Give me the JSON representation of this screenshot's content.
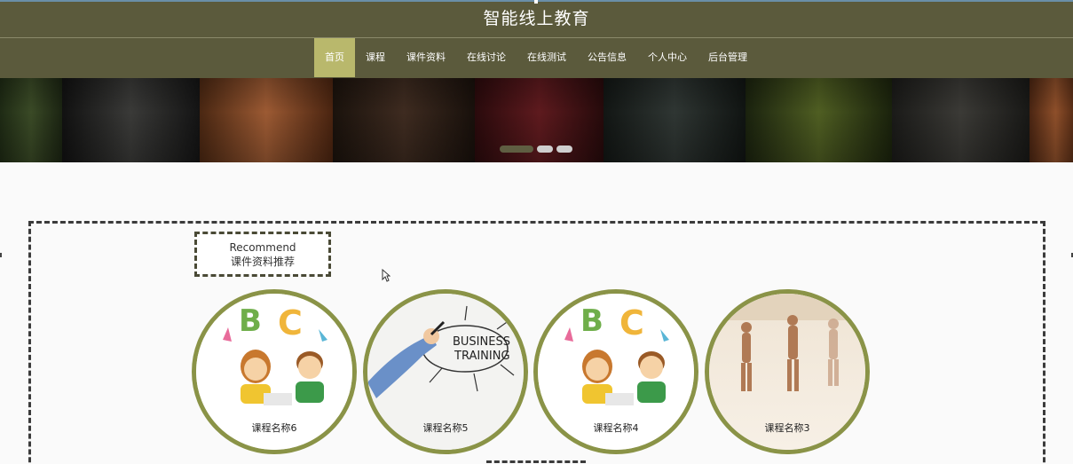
{
  "header": {
    "site_title": "智能线上教育"
  },
  "nav": {
    "items": [
      {
        "label": "首页",
        "active": true
      },
      {
        "label": "课程",
        "active": false
      },
      {
        "label": "课件资料",
        "active": false
      },
      {
        "label": "在线讨论",
        "active": false
      },
      {
        "label": "在线测试",
        "active": false
      },
      {
        "label": "公告信息",
        "active": false
      },
      {
        "label": "个人中心",
        "active": false
      },
      {
        "label": "后台管理",
        "active": false
      }
    ]
  },
  "banner": {
    "slides": 3,
    "active_slide": 1
  },
  "recommend": {
    "title_en": "Recommend",
    "title_cn": "课件资料推荐",
    "items": [
      {
        "name": "课程名称6",
        "image": "kids-abc-illustration"
      },
      {
        "name": "课程名称5",
        "image": "business-training-sketch"
      },
      {
        "name": "课程名称4",
        "image": "kids-abc-illustration"
      },
      {
        "name": "课程名称3",
        "image": "yoga-class-photo"
      }
    ]
  },
  "colors": {
    "header_bg": "#5b5a3c",
    "nav_active": "#b9b86c",
    "card_ring": "#8a9347"
  }
}
